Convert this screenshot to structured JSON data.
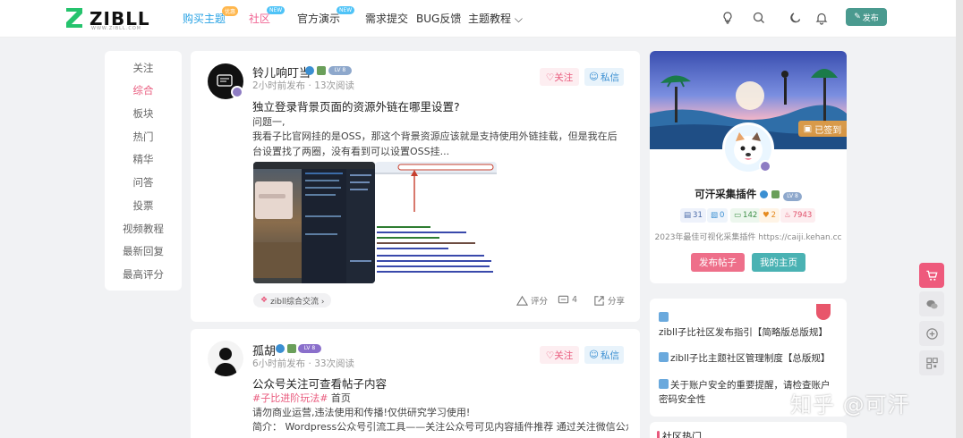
{
  "header": {
    "logo_text": "ZIBLL",
    "logo_sub": "WWW.ZIBLL.COM",
    "nav": [
      {
        "label": "购买主题",
        "badge": "优惠"
      },
      {
        "label": "社区",
        "badge": "NEW"
      },
      {
        "label": "官方演示",
        "badge": "NEW"
      },
      {
        "label": "需求提交"
      },
      {
        "label": "BUG反馈"
      },
      {
        "label": "主题教程 ⌵"
      }
    ],
    "publish_label": "发布",
    "icons": [
      "bulb-icon",
      "search-icon",
      "moon-icon",
      "bell-icon",
      "pencil-icon"
    ]
  },
  "left_menu": {
    "items": [
      "关注",
      "综合",
      "板块",
      "热门",
      "精华",
      "问答",
      "投票",
      "视频教程",
      "最新回复",
      "最高评分"
    ],
    "active_index": 1
  },
  "posts": [
    {
      "author": "铃儿响叮当",
      "level": "LV 8",
      "meta": "2小时前发布 · 13次阅读",
      "follow_label": "♡关注",
      "message_label": "私信",
      "title": "独立登录背景页面的资源外链在哪里设置?",
      "body_1": "问题一,",
      "body_2": "我看子比官网挂的是OSS，那这个背景资源应该就是支持使用外链挂载，但是我在后台设置找了两圈，没有看到可以设置OSS挂...",
      "tag": "zibll综合交流 ›",
      "actions": {
        "rate": "评分",
        "comments": "4",
        "share": "分享"
      }
    },
    {
      "author": "孤胡",
      "level": "LV 8",
      "meta": "6小时前发布 · 33次阅读",
      "follow_label": "♡关注",
      "message_label": "私信",
      "title": "公众号关注可查看帖子内容",
      "topic": "#子比进阶玩法#",
      "topic_suffix": " 首页",
      "body_1": "请勿商业运营,违法使用和传播!仅供研究学习使用!",
      "body_2": "简介：  Wordpress公众号引流工具——关注公众号可见内容插件推荐 通过关注微信公众号，获"
    }
  ],
  "profile": {
    "name": "可汗采集插件",
    "level": "LV 8",
    "signed_label": "已签到",
    "stats": [
      "31",
      "0",
      "142",
      "2",
      "7943"
    ],
    "desc": "2023年最佳可视化采集插件 https://caiji.kehan.cc",
    "btn_post": "发布帖子",
    "btn_home": "我的主页"
  },
  "notices": [
    "zibll子比社区发布指引【简略版总版规】",
    "zibll子比主题社区管理制度【总版规】",
    "关于账户安全的重要提醒，请检查账户密码安全性"
  ],
  "hot_title": "社区热门",
  "watermark": "知乎 @可汗",
  "colors": {
    "accent": "#e95a7d",
    "blue": "#27a2e4",
    "teal": "#4a9a8f"
  }
}
